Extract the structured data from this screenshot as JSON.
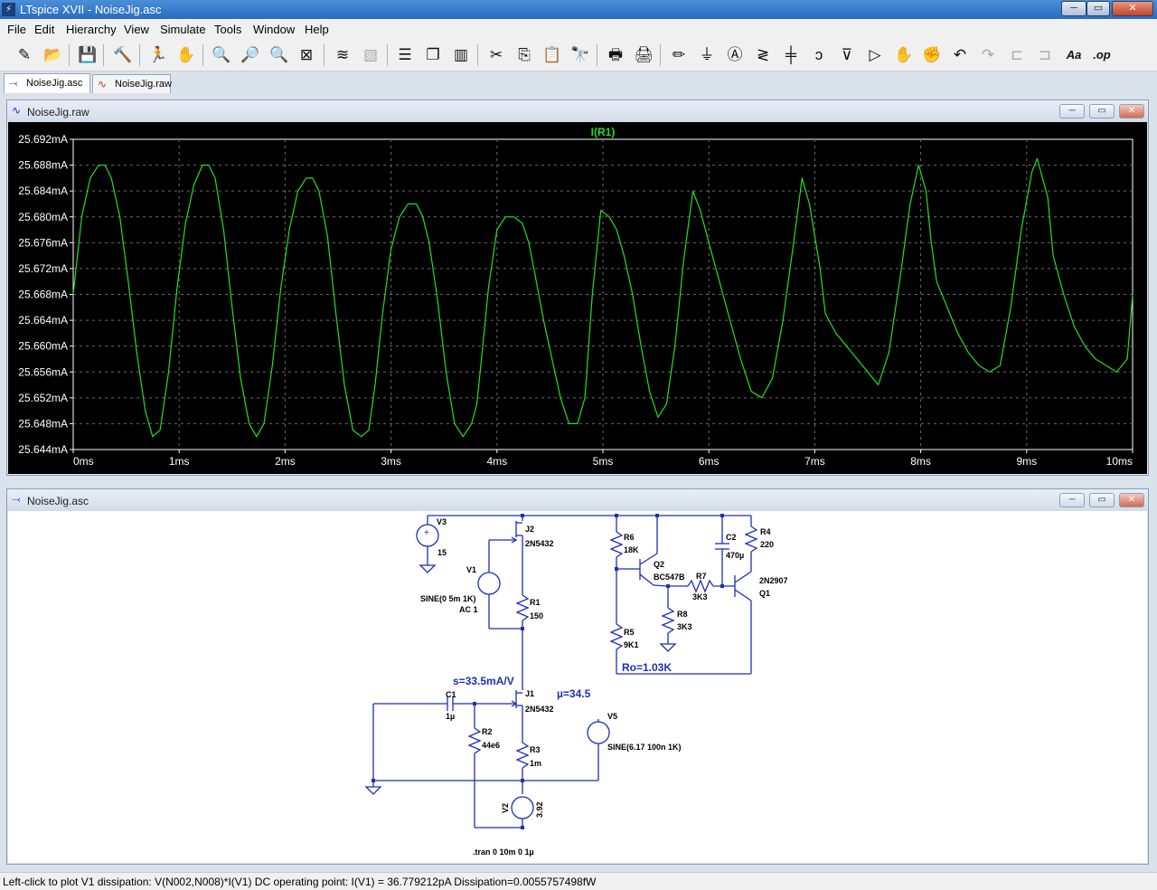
{
  "window": {
    "title": "LTspice XVII - NoiseJig.asc",
    "app_icon": "ltspice-icon",
    "controls": {
      "minimize": "─",
      "maximize": "▭",
      "close": "✕"
    }
  },
  "menu": [
    "File",
    "Edit",
    "Hierarchy",
    "View",
    "Simulate",
    "Tools",
    "Window",
    "Help"
  ],
  "toolbar": [
    {
      "name": "new-schematic-icon",
      "glyph": "✎"
    },
    {
      "name": "open-folder-icon",
      "glyph": "📂"
    },
    {
      "name": "save-icon",
      "glyph": "💾"
    },
    {
      "name": "control-panel-icon",
      "glyph": "🔨"
    },
    {
      "name": "run-icon",
      "glyph": "🏃"
    },
    {
      "name": "halt-icon",
      "glyph": "✋"
    },
    {
      "name": "zoom-in-icon",
      "glyph": "🔍"
    },
    {
      "name": "zoom-pan-icon",
      "glyph": "🔎"
    },
    {
      "name": "zoom-out-icon",
      "glyph": "🔍"
    },
    {
      "name": "zoom-fit-icon",
      "glyph": "⊠"
    },
    {
      "name": "autorange-icon",
      "glyph": "≋"
    },
    {
      "name": "cursor-mode-icon",
      "glyph": "▧"
    },
    {
      "name": "tile-horizontal-icon",
      "glyph": "☰"
    },
    {
      "name": "cascade-icon",
      "glyph": "❐"
    },
    {
      "name": "tile-vertical-icon",
      "glyph": "▥"
    },
    {
      "name": "cut-icon",
      "glyph": "✂"
    },
    {
      "name": "copy-icon",
      "glyph": "⎘"
    },
    {
      "name": "paste-icon",
      "glyph": "📋"
    },
    {
      "name": "find-icon",
      "glyph": "🔭"
    },
    {
      "name": "print-icon",
      "glyph": "🖶"
    },
    {
      "name": "print-setup-icon",
      "glyph": "🖨"
    },
    {
      "name": "draw-wire-icon",
      "glyph": "✏"
    },
    {
      "name": "ground-icon",
      "glyph": "⏚"
    },
    {
      "name": "label-net-icon",
      "glyph": "Ⓐ"
    },
    {
      "name": "resistor-icon",
      "glyph": "≷"
    },
    {
      "name": "capacitor-icon",
      "glyph": "╪"
    },
    {
      "name": "inductor-icon",
      "glyph": "ↄ"
    },
    {
      "name": "diode-icon",
      "glyph": "⊽"
    },
    {
      "name": "component-icon",
      "glyph": "▷"
    },
    {
      "name": "move-icon",
      "glyph": "✋"
    },
    {
      "name": "drag-icon",
      "glyph": "✊"
    },
    {
      "name": "undo-icon",
      "glyph": "↶"
    },
    {
      "name": "redo-icon",
      "glyph": "↷"
    },
    {
      "name": "rotate-icon",
      "glyph": "⊏"
    },
    {
      "name": "mirror-icon",
      "glyph": "⊐"
    },
    {
      "name": "text-icon",
      "glyph": "Aa"
    },
    {
      "name": "spice-directive-icon",
      "glyph": ".op"
    }
  ],
  "tabs": [
    {
      "label": "NoiseJig.asc",
      "icon": "schematic-tab-icon",
      "active": true
    },
    {
      "label": "NoiseJig.raw",
      "icon": "waveform-tab-icon",
      "active": false
    }
  ],
  "plot_window": {
    "title": "NoiseJig.raw",
    "controls": {
      "minimize": "─",
      "maximize": "▭",
      "close": "✕"
    },
    "trace_color": "#22e022",
    "grid_color": "#6a6a6a",
    "background": "#000000"
  },
  "schematic_window": {
    "title": "NoiseJig.asc",
    "controls": {
      "minimize": "─",
      "maximize": "▭",
      "close": "✕"
    },
    "wire_color": "#1d2fb5",
    "labels": {
      "v3": "V3",
      "v3_val": "15",
      "j2": "J2",
      "j2_model": "2N5432",
      "v1": "V1",
      "v1_val": "SINE(0 5m 1K)",
      "v1_ac": "AC 1",
      "r1": "R1",
      "r1_val": "150",
      "r6": "R6",
      "r6_val": "18K",
      "q2": "Q2",
      "q2_model": "BC547B",
      "c2": "C2",
      "c2_val": "470µ",
      "r4": "R4",
      "r4_val": "220",
      "r7": "R7",
      "r7_val": "3K3",
      "q1_model": "2N2907",
      "q1": "Q1",
      "r8": "R8",
      "r8_val": "3K3",
      "r5": "R5",
      "r5_val": "9K1",
      "ro_note": "Ro=1.03K",
      "s_note": "s=33.5mA/V",
      "mu_note": "µ=34.5",
      "j1": "J1",
      "j1_model": "2N5432",
      "c1": "C1",
      "c1_val": "1µ",
      "r2": "R2",
      "r2_val": "44e6",
      "r3": "R3",
      "r3_val": "1m",
      "v5": "V5",
      "v5_val": "SINE(6.17 100n 1K)",
      "v2": "V2",
      "v2_val": "3.92",
      "tran": ".tran 0 10m 0 1µ"
    }
  },
  "chart_data": {
    "type": "line",
    "title": "I(R1)",
    "xlabel": "",
    "ylabel": "",
    "xlim": [
      0,
      10
    ],
    "ylim": [
      25.644,
      25.692
    ],
    "grid": true,
    "x_ticks": [
      "0ms",
      "1ms",
      "2ms",
      "3ms",
      "4ms",
      "5ms",
      "6ms",
      "7ms",
      "8ms",
      "9ms",
      "10ms"
    ],
    "y_ticks": [
      "25.692mA",
      "25.688mA",
      "25.684mA",
      "25.680mA",
      "25.676mA",
      "25.672mA",
      "25.668mA",
      "25.664mA",
      "25.660mA",
      "25.656mA",
      "25.652mA",
      "25.648mA",
      "25.644mA"
    ],
    "series": [
      {
        "name": "I(R1)",
        "x_unit": "ms",
        "y_unit": "mA",
        "x": [
          0,
          0.08,
          0.16,
          0.24,
          0.3,
          0.36,
          0.44,
          0.52,
          0.6,
          0.68,
          0.75,
          0.82,
          0.9,
          0.98,
          1.06,
          1.14,
          1.22,
          1.28,
          1.34,
          1.42,
          1.5,
          1.58,
          1.66,
          1.73,
          1.8,
          1.88,
          1.96,
          2.04,
          2.12,
          2.2,
          2.26,
          2.32,
          2.4,
          2.48,
          2.56,
          2.64,
          2.72,
          2.79,
          2.85,
          2.92,
          3.0,
          3.08,
          3.16,
          3.24,
          3.3,
          3.36,
          3.44,
          3.52,
          3.6,
          3.68,
          3.76,
          3.81,
          3.86,
          3.92,
          4.0,
          4.08,
          4.16,
          4.24,
          4.3,
          4.36,
          4.44,
          4.52,
          4.6,
          4.68,
          4.76,
          4.83,
          4.9,
          4.98,
          5.06,
          5.13,
          5.2,
          5.28,
          5.36,
          5.44,
          5.52,
          5.6,
          5.68,
          5.76,
          5.85,
          5.92,
          6.0,
          6.1,
          6.2,
          6.3,
          6.4,
          6.5,
          6.6,
          6.7,
          6.8,
          6.88,
          6.95,
          7.05,
          7.1,
          7.2,
          7.3,
          7.4,
          7.5,
          7.6,
          7.7,
          7.8,
          7.9,
          7.98,
          8.05,
          8.1,
          8.15,
          8.25,
          8.35,
          8.45,
          8.55,
          8.65,
          8.75,
          8.85,
          8.95,
          9.05,
          9.1,
          9.2,
          9.25,
          9.35,
          9.45,
          9.55,
          9.65,
          9.75,
          9.85,
          9.95,
          10.0
        ],
        "y": [
          25.668,
          25.68,
          25.686,
          25.688,
          25.688,
          25.686,
          25.68,
          25.67,
          25.659,
          25.65,
          25.646,
          25.647,
          25.656,
          25.669,
          25.679,
          25.685,
          25.688,
          25.688,
          25.686,
          25.678,
          25.666,
          25.655,
          25.648,
          25.646,
          25.648,
          25.657,
          25.669,
          25.678,
          25.684,
          25.686,
          25.686,
          25.684,
          25.677,
          25.665,
          25.654,
          25.647,
          25.646,
          25.647,
          25.654,
          25.665,
          25.675,
          25.68,
          25.682,
          25.682,
          25.68,
          25.676,
          25.667,
          25.656,
          25.648,
          25.646,
          25.648,
          25.651,
          25.659,
          25.669,
          25.678,
          25.68,
          25.68,
          25.679,
          25.676,
          25.671,
          25.664,
          25.658,
          25.652,
          25.648,
          25.648,
          25.652,
          25.668,
          25.681,
          25.68,
          25.678,
          25.674,
          25.668,
          25.66,
          25.653,
          25.649,
          25.651,
          25.66,
          25.673,
          25.684,
          25.681,
          25.676,
          25.67,
          25.664,
          25.658,
          25.653,
          25.652,
          25.655,
          25.664,
          25.676,
          25.686,
          25.682,
          25.672,
          25.665,
          25.662,
          25.66,
          25.658,
          25.656,
          25.654,
          25.659,
          25.67,
          25.682,
          25.688,
          25.684,
          25.676,
          25.67,
          25.666,
          25.662,
          25.659,
          25.657,
          25.656,
          25.657,
          25.666,
          25.678,
          25.687,
          25.689,
          25.683,
          25.674,
          25.668,
          25.663,
          25.66,
          25.658,
          25.657,
          25.656,
          25.658,
          25.668
        ]
      }
    ]
  },
  "status": "Left-click to plot V1 dissipation: V(N002,N008)*I(V1)  DC operating point: I(V1) = 36.779212pA   Dissipation=0.0055757498fW"
}
